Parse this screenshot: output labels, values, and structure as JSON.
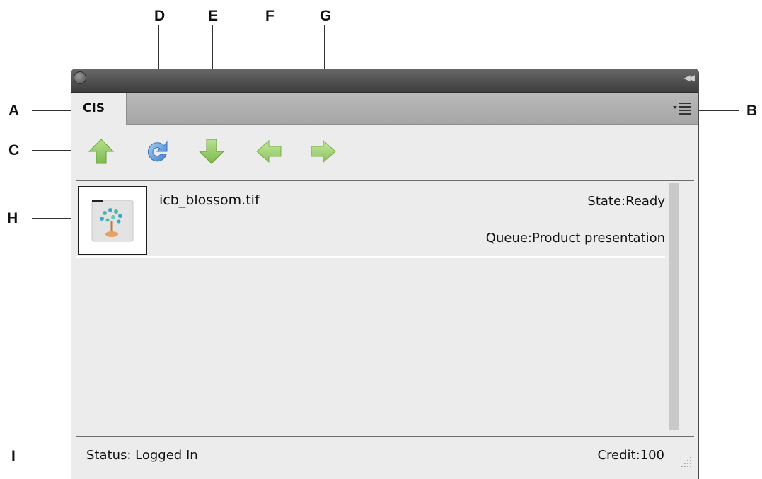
{
  "callouts": {
    "A": "A",
    "B": "B",
    "C": "C",
    "D": "D",
    "E": "E",
    "F": "F",
    "G": "G",
    "H": "H",
    "I": "I"
  },
  "panel": {
    "tab_label": "CIS",
    "toolbar": {
      "buttons": [
        {
          "name": "upload",
          "icon": "arrow-up-icon",
          "color": "#8fc95b"
        },
        {
          "name": "refresh",
          "icon": "refresh-icon",
          "color": "#4b8fd8"
        },
        {
          "name": "download",
          "icon": "arrow-down-icon",
          "color": "#8fc95b"
        },
        {
          "name": "previous",
          "icon": "arrow-left-icon",
          "color": "#8fc95b"
        },
        {
          "name": "next",
          "icon": "arrow-right-icon",
          "color": "#8fc95b"
        }
      ]
    },
    "jobs": [
      {
        "filename": "icb_blossom.tif",
        "state": "State:Ready",
        "queue": "Queue:Product presentation"
      }
    ],
    "status": "Status: Logged In",
    "credit": "Credit:100"
  },
  "colors": {
    "panel_bg": "#ececec",
    "titlebar": "#4a4a4a",
    "arrow_green": "#8fc95b",
    "refresh_blue": "#4b8fd8"
  }
}
